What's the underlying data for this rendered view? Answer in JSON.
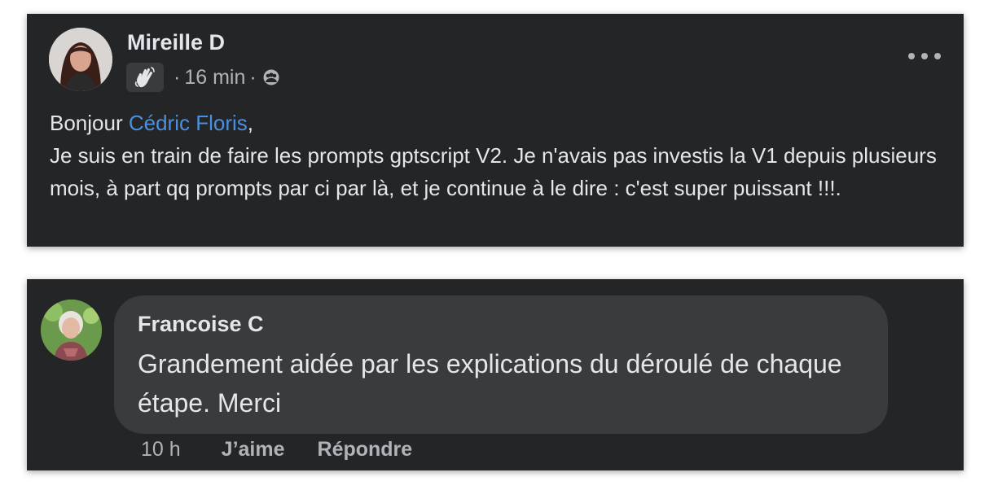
{
  "post": {
    "author": "Mireille D",
    "time": "16 min",
    "separator": "·",
    "badge_icon": "waving-hand-badge-icon",
    "audience_icon": "group-audience-icon",
    "body": {
      "greeting": "Bonjour ",
      "mention": "Cédric Floris",
      "after_mention": ",",
      "text": "Je suis en train de faire les prompts gptscript V2. Je n'avais pas investis la V1 depuis plusieurs mois, à part qq prompts par ci par là, et je continue à le dire : c'est super puissant !!!."
    }
  },
  "comment": {
    "author": "Francoise C",
    "text": "Grandement aidée par les explications du déroulé de chaque étape. Merci",
    "time": "10 h",
    "like_label": "J’aime",
    "reply_label": "Répondre"
  },
  "colors": {
    "card_bg": "#242526",
    "bubble_bg": "#3a3b3c",
    "text_primary": "#e4e6eb",
    "text_secondary": "#b0b3b8",
    "mention": "#4a90e2"
  }
}
